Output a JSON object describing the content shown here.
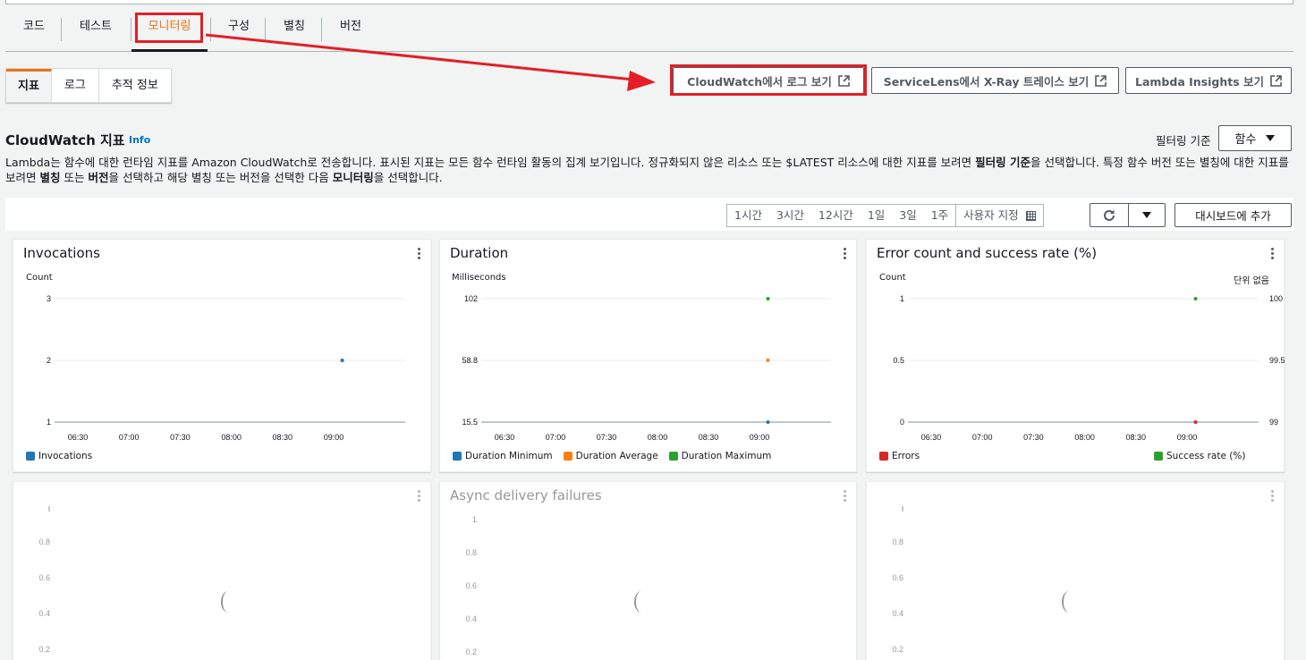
{
  "main_tabs": [
    "코드",
    "테스트",
    "모니터링",
    "구성",
    "별칭",
    "버전"
  ],
  "sub_tabs": [
    "지표",
    "로그",
    "추적 정보"
  ],
  "header_buttons": {
    "cloudwatch_logs": "CloudWatch에서 로그 보기",
    "xray": "ServiceLens에서 X-Ray 트레이스 보기",
    "insights": "Lambda Insights 보기"
  },
  "section": {
    "title": "CloudWatch 지표",
    "info": "Info",
    "desc_part1": "Lambda는 함수에 대한 런타임 지표를 Amazon CloudWatch로 전송합니다. 표시된 지표는 모든 함수 런타임 활동의 집계 보기입니다. 정규화되지 않은 리소스 또는 $LATEST 리소스에 대한 지표를 보려면 ",
    "desc_b1": "필터링 기준",
    "desc_part2": "을 선택합니다. 특정 함수 버전 또는 별칭에 대한 지표를 보려면 ",
    "desc_b2": "별칭",
    "desc_part3": " 또는 ",
    "desc_b3": "버전",
    "desc_part4": "을 선택하고 해당 별칭 또는 버전을 선택한 다음 ",
    "desc_b4": "모니터링",
    "desc_part5": "을 선택합니다."
  },
  "filter": {
    "label": "필터링 기준",
    "value": "함수"
  },
  "time_ranges": [
    "1시간",
    "3시간",
    "12시간",
    "1일",
    "3일",
    "1주"
  ],
  "custom_range": "사용자 지정",
  "add_to_dashboard": "대시보드에 추가",
  "x_ticks": [
    "06:30",
    "07:00",
    "07:30",
    "08:00",
    "08:30",
    "09:00"
  ],
  "colors": {
    "blue": "#1f77b4",
    "orange": "#ff7f0e",
    "green": "#2ca02c",
    "red": "#d62728",
    "accent": "#ec7211",
    "link": "#0073bb"
  },
  "widgets": {
    "invocations": {
      "title": "Invocations",
      "unit": "Count",
      "y_ticks": [
        "3",
        "2",
        "1"
      ],
      "legend": [
        "Invocations"
      ]
    },
    "duration": {
      "title": "Duration",
      "unit": "Milliseconds",
      "y_ticks": [
        "102",
        "58.8",
        "15.5"
      ],
      "legend": [
        "Duration Minimum",
        "Duration Average",
        "Duration Maximum"
      ]
    },
    "errors": {
      "title": "Error count and success rate (%)",
      "unit": "Count",
      "unit_right": "단위 없음",
      "y_ticks": [
        "1",
        "0.5",
        "0"
      ],
      "y_ticks_right": [
        "100",
        "99.5",
        "99"
      ],
      "legend": [
        "Errors",
        "Success rate (%)"
      ]
    },
    "throttles": {
      "title": "",
      "y_ticks": [
        "0.8",
        "0.6",
        "0.4",
        "0.2"
      ]
    },
    "async": {
      "title": "Async delivery failures",
      "y_ticks": [
        "1",
        "0.8",
        "0.6",
        "0.4",
        "0.2"
      ]
    },
    "concurrency": {
      "title": "",
      "y_ticks": [
        "0.8",
        "0.6",
        "0.4",
        "0.2"
      ]
    }
  },
  "chart_data": [
    {
      "type": "scatter",
      "title": "Invocations",
      "ylabel": "Count",
      "ylim": [
        1,
        3
      ],
      "x": [
        "09:05"
      ],
      "series": [
        {
          "name": "Invocations",
          "values": [
            2
          ]
        }
      ]
    },
    {
      "type": "scatter",
      "title": "Duration",
      "ylabel": "Milliseconds",
      "ylim": [
        15.5,
        102
      ],
      "x": [
        "09:05"
      ],
      "series": [
        {
          "name": "Duration Minimum",
          "values": [
            15.5
          ]
        },
        {
          "name": "Duration Average",
          "values": [
            58.8
          ]
        },
        {
          "name": "Duration Maximum",
          "values": [
            102
          ]
        }
      ]
    },
    {
      "type": "scatter",
      "title": "Error count and success rate (%)",
      "ylabel": "Count",
      "ylim": [
        0,
        1
      ],
      "x": [
        "09:05"
      ],
      "series": [
        {
          "name": "Errors",
          "values": [
            0
          ]
        },
        {
          "name": "Success rate (%)",
          "values": [
            100
          ]
        }
      ]
    }
  ]
}
